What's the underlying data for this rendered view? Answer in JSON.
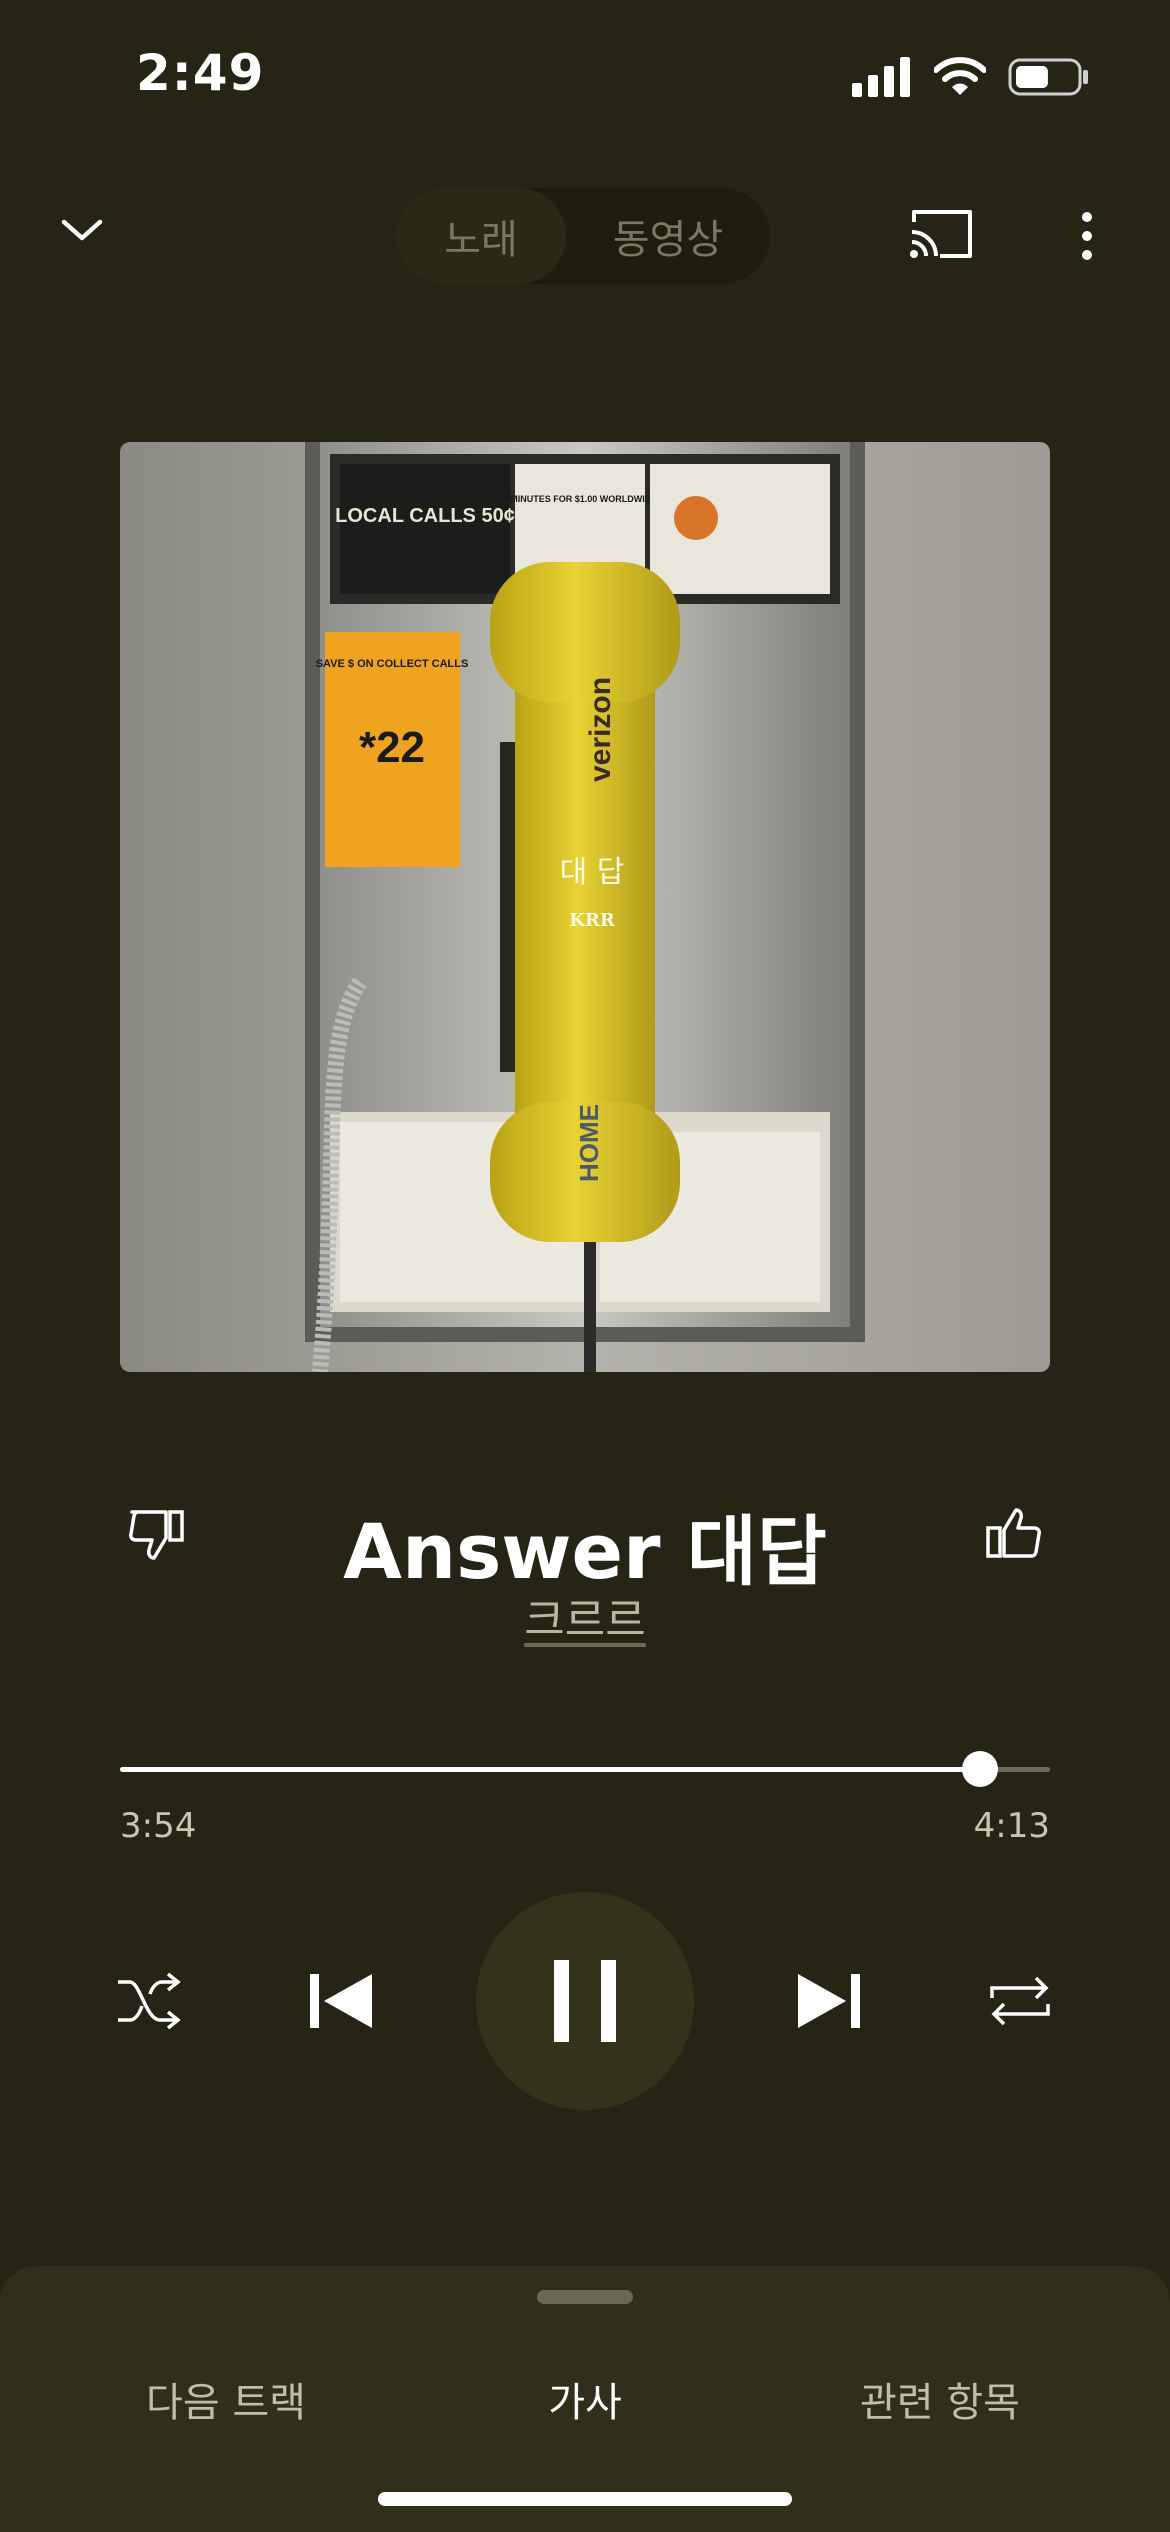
{
  "status_bar": {
    "time": "2:49",
    "icons": [
      "cellular-signal-icon",
      "wifi-icon",
      "battery-icon"
    ],
    "battery_level": 0.55
  },
  "header": {
    "icons": [
      "chevron-down-icon",
      "cast-icon",
      "more-vertical-icon"
    ],
    "segments": [
      {
        "label": "노래",
        "selected": true
      },
      {
        "label": "동영상",
        "selected": false
      }
    ]
  },
  "artwork": {
    "description_icon": "album-art-payphone",
    "embedded_text": [
      "대 답",
      "KRR",
      "SAVE $ ON COLLECT CALLS",
      "*22",
      "LOCAL CALLS 50¢",
      "4 MINUTES FOR $1.00 WORLDWIDE",
      "verizon",
      "HOME"
    ]
  },
  "track": {
    "title": "Answer 대답",
    "artist": "크르르",
    "dislike_icon": "thumbs-down-icon",
    "like_icon": "thumbs-up-icon"
  },
  "progress": {
    "current": "3:54",
    "total": "4:13",
    "fraction": 0.925
  },
  "controls": {
    "icons": [
      "shuffle-icon",
      "previous-icon",
      "pause-icon",
      "next-icon",
      "repeat-icon"
    ]
  },
  "bottom_sheet": {
    "tabs": [
      {
        "label": "다음 트랙",
        "active": false
      },
      {
        "label": "가사",
        "active": true
      },
      {
        "label": "관련 항목",
        "active": false
      }
    ]
  },
  "colors": {
    "background": "#262414",
    "sheet": "#312e1a",
    "accent": "#ffffff"
  }
}
